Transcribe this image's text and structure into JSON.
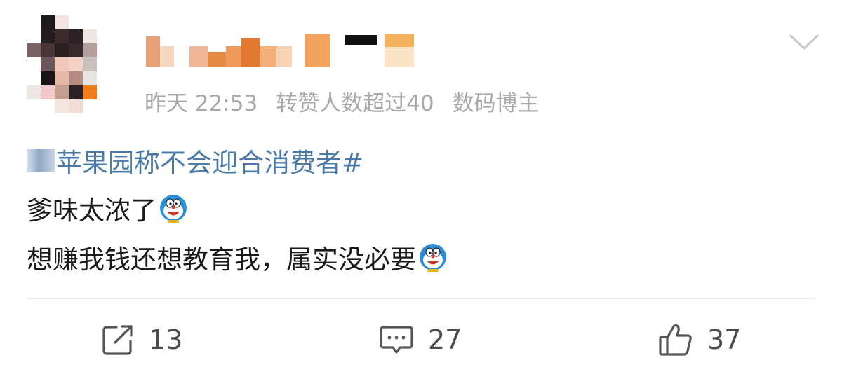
{
  "post": {
    "meta": {
      "time": "昨天 22:53",
      "repost_badge": "转赞人数超过40",
      "category": "数码博主"
    },
    "hashtag": "#苹果园称不会迎合消费者#",
    "hashtag_visible": "苹果园称不会迎合消费者#",
    "lines": [
      "爹味太浓了",
      "想赚我钱还想教育我，属实没必要"
    ]
  },
  "actions": {
    "repost_count": "13",
    "comment_count": "27",
    "like_count": "37"
  },
  "icons": {
    "collapse": "chevron-down-icon",
    "repost": "share-icon",
    "comment": "comment-icon",
    "like": "thumbs-up-icon",
    "emoji": "doraemon-emoji-icon"
  },
  "colors": {
    "link": "#4a7aa8",
    "meta": "#a8a8a8",
    "text": "#1a1a1a",
    "icon": "#555555"
  }
}
